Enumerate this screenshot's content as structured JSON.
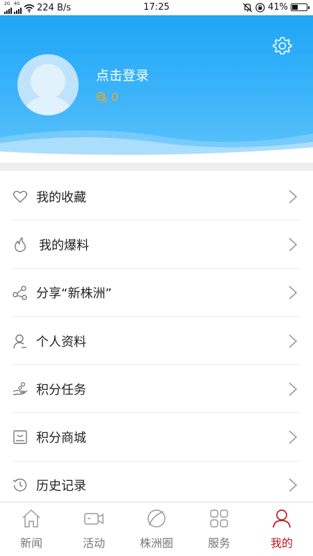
{
  "status_bar": {
    "net_speed": "224 B/s",
    "time": "17:25",
    "battery": "41%",
    "battery_level": 0.41,
    "sim1": "2G",
    "sim2": "4G"
  },
  "profile": {
    "login_text": "点击登录",
    "coins": "0"
  },
  "menu": {
    "items": [
      {
        "label": "我的收藏",
        "icon": "heart-icon"
      },
      {
        "label": "我的爆料",
        "icon": "flame-icon"
      },
      {
        "label": "分享“新株洲”",
        "icon": "share-icon"
      },
      {
        "label": "个人资料",
        "icon": "user-icon"
      },
      {
        "label": "积分任务",
        "icon": "hand-coins-icon"
      },
      {
        "label": "积分商城",
        "icon": "store-icon"
      },
      {
        "label": "历史记录",
        "icon": "history-icon"
      }
    ]
  },
  "tabbar": {
    "tabs": [
      {
        "label": "新闻",
        "icon": "home-icon",
        "active": false
      },
      {
        "label": "活动",
        "icon": "video-icon",
        "active": false
      },
      {
        "label": "株洲圈",
        "icon": "leaf-icon",
        "active": false
      },
      {
        "label": "服务",
        "icon": "grid-icon",
        "active": false
      },
      {
        "label": "我的",
        "icon": "person-icon",
        "active": true
      }
    ]
  },
  "colors": {
    "header_blue": "#1ea6f6",
    "accent_red": "#c0141a",
    "coin_orange": "#f6a623",
    "icon_gray": "#888888"
  }
}
